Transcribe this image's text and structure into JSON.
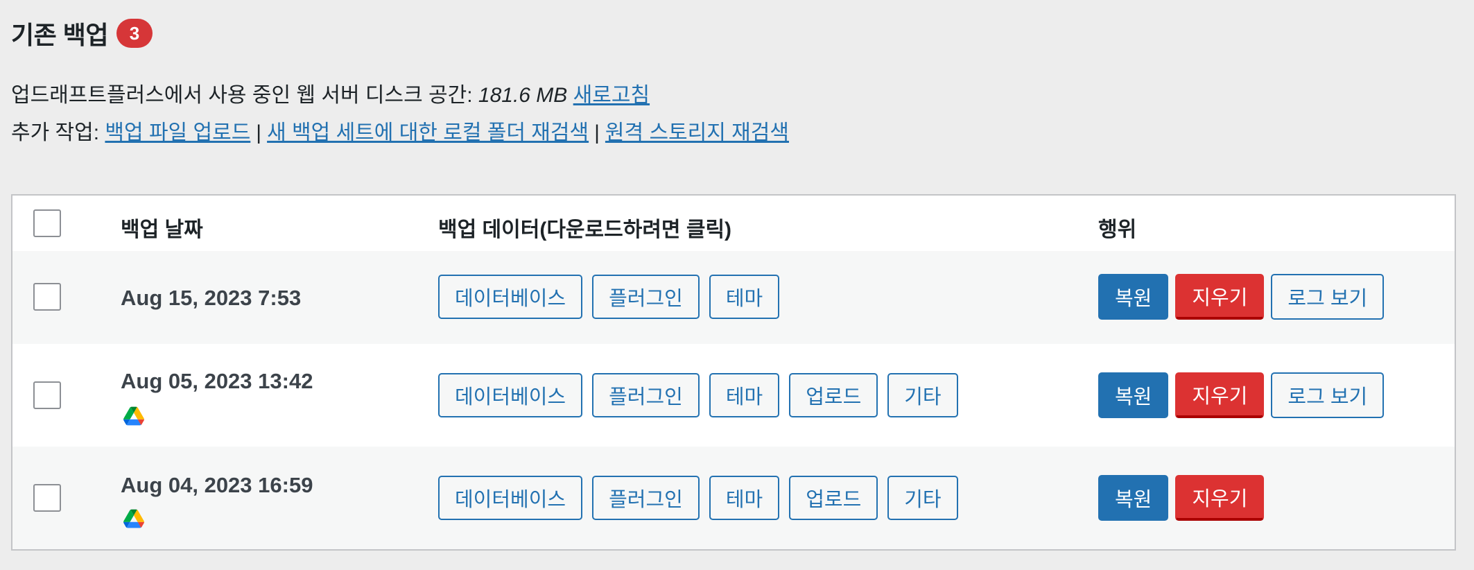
{
  "header": {
    "title": "기존 백업",
    "count": "3"
  },
  "disk": {
    "label": "업드래프트플러스에서 사용 중인 웹 서버 디스크 공간:",
    "value": "181.6 MB",
    "refresh_link": "새로고침"
  },
  "more": {
    "label": "추가 작업:",
    "upload_link": "백업 파일 업로드",
    "rescan_local_link": "새 백업 세트에 대한 로컬 폴더 재검색",
    "rescan_remote_link": "원격 스토리지 재검색",
    "separator": "|"
  },
  "table": {
    "columns": {
      "date": "백업 날짜",
      "data": "백업 데이터(다운로드하려면 클릭)",
      "actions": "행위"
    },
    "rows": [
      {
        "date": "Aug 15, 2023 7:53",
        "remote_icon": "",
        "data_buttons": [
          "데이터베이스",
          "플러그인",
          "테마"
        ],
        "restore": "복원",
        "delete": "지우기",
        "log": "로그 보기"
      },
      {
        "date": "Aug 05, 2023 13:42",
        "remote_icon": "google-drive-icon",
        "data_buttons": [
          "데이터베이스",
          "플러그인",
          "테마",
          "업로드",
          "기타"
        ],
        "restore": "복원",
        "delete": "지우기",
        "log": "로그 보기"
      },
      {
        "date": "Aug 04, 2023 16:59",
        "remote_icon": "google-drive-icon",
        "data_buttons": [
          "데이터베이스",
          "플러그인",
          "테마",
          "업로드",
          "기타"
        ],
        "restore": "복원",
        "delete": "지우기",
        "log": ""
      }
    ]
  },
  "colors": {
    "link": "#2271b1",
    "badge": "#d63638",
    "delete": "#dc3232",
    "row_alt": "#f6f7f7"
  }
}
